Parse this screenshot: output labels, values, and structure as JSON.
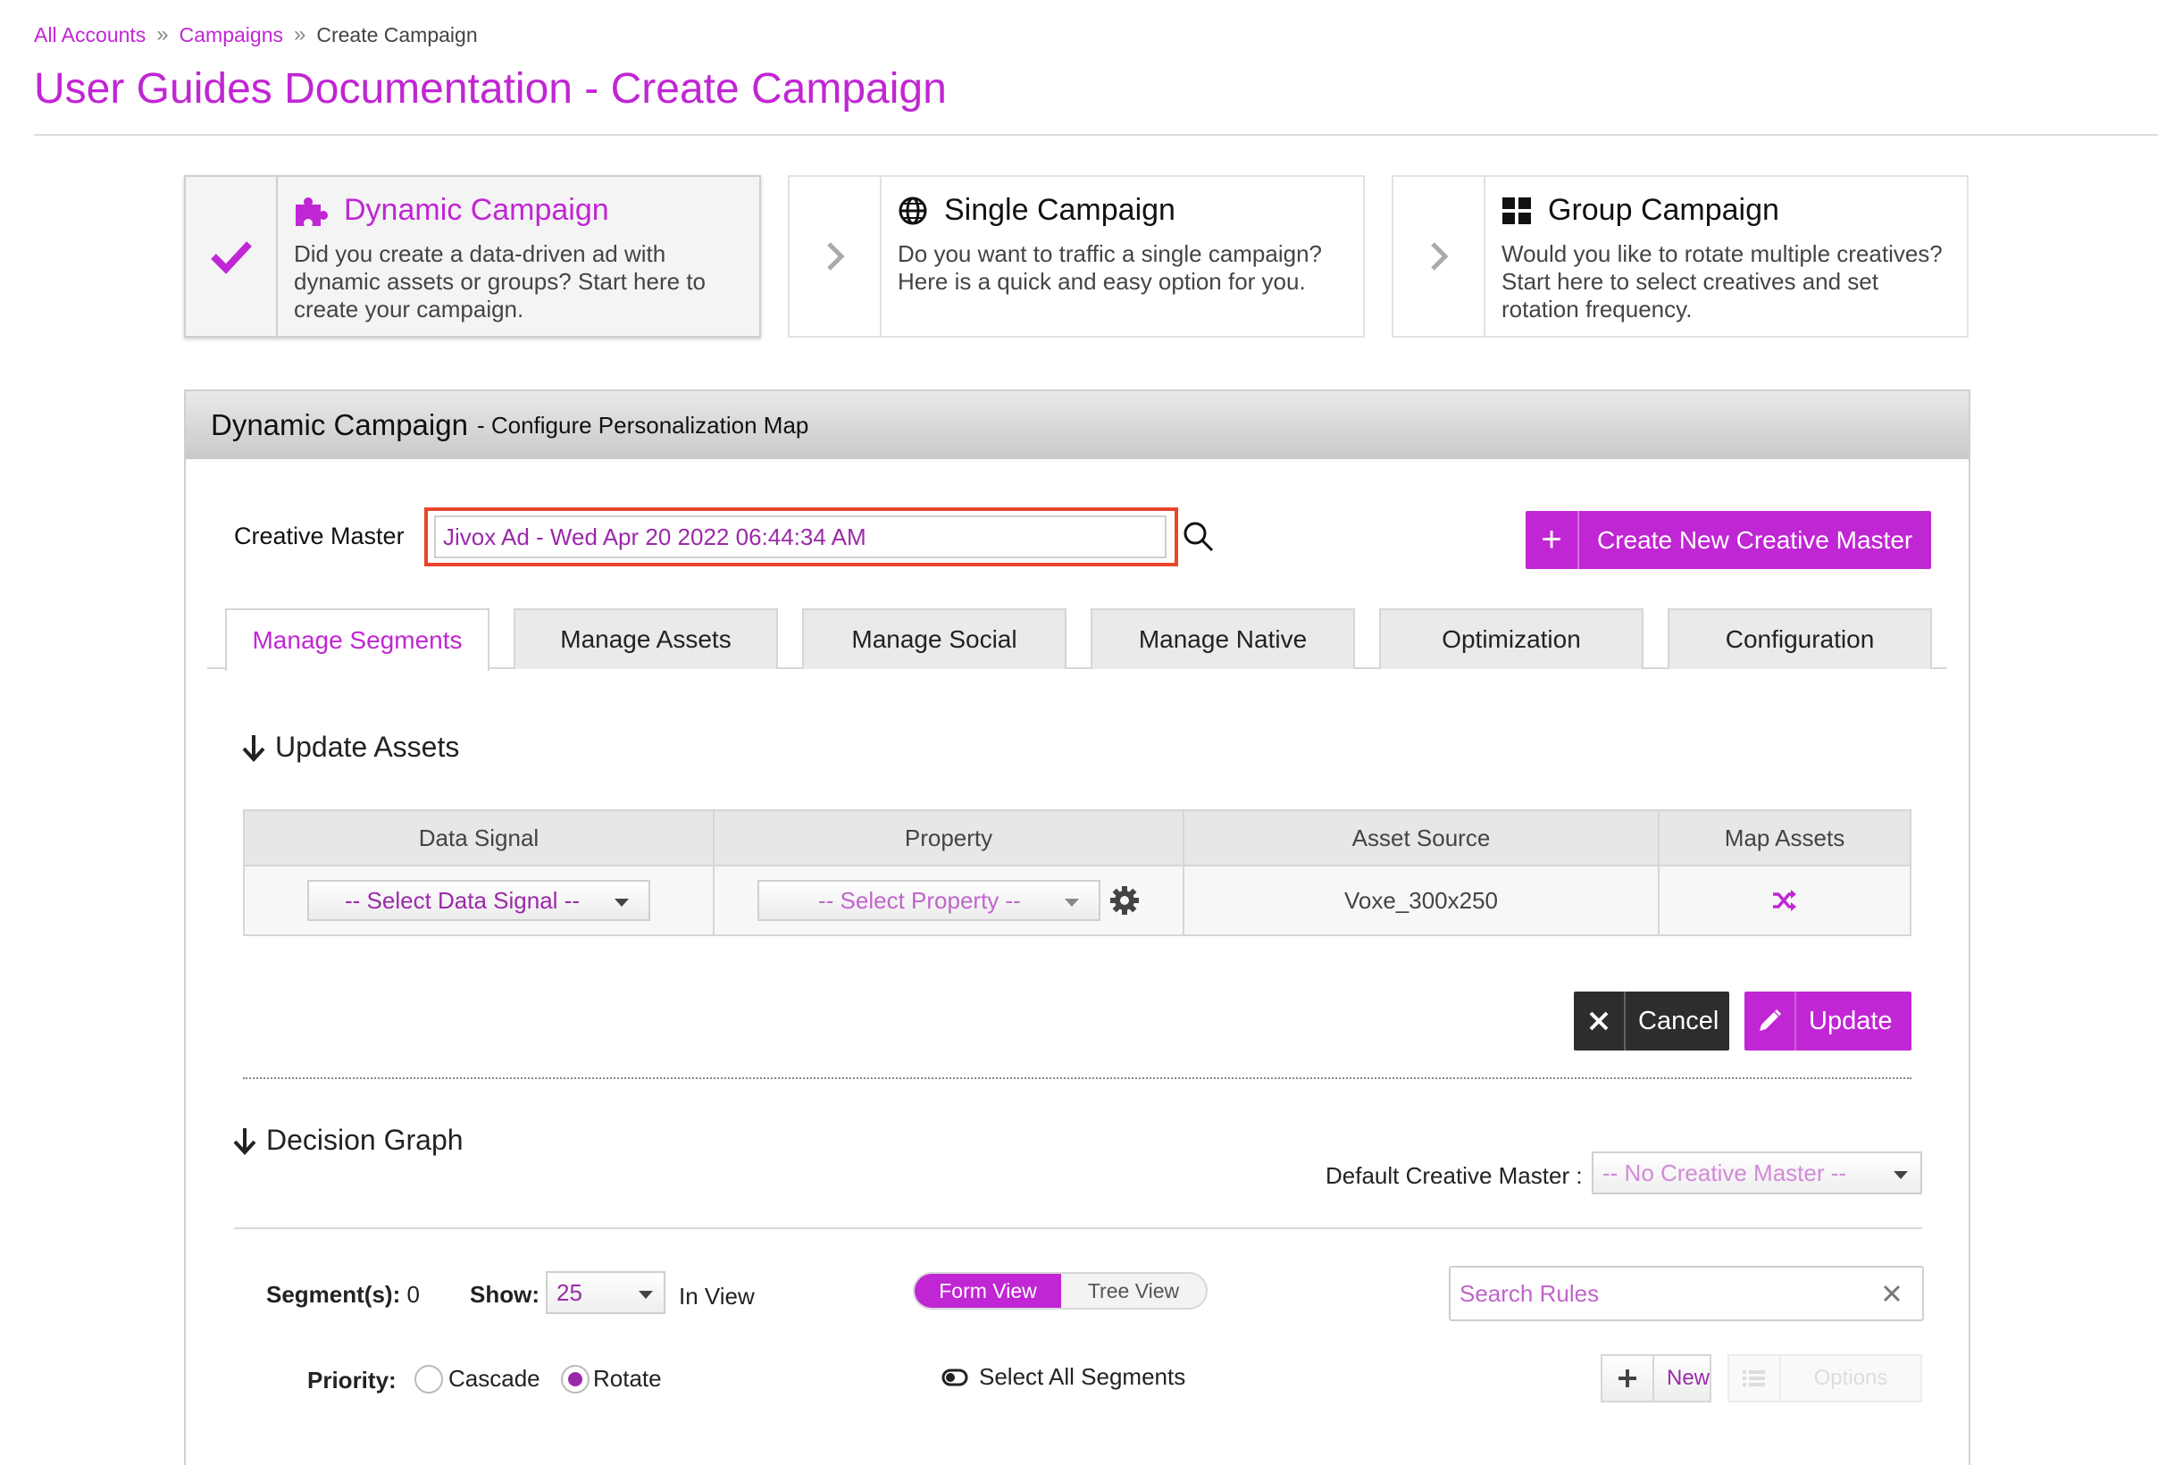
{
  "breadcrumb": {
    "items": [
      "All Accounts",
      "Campaigns",
      "Create Campaign"
    ],
    "separator": "»"
  },
  "page_title": "User Guides Documentation - Create Campaign",
  "cards": [
    {
      "title": "Dynamic Campaign",
      "desc_lines": [
        "Did you create a data-driven ad with",
        "dynamic assets or groups? Start here to",
        "create your campaign."
      ],
      "selected": true
    },
    {
      "title": "Single Campaign",
      "desc_lines": [
        "Do you want to traffic a single campaign?",
        "Here is a quick and easy option for you."
      ],
      "selected": false
    },
    {
      "title": "Group Campaign",
      "desc_lines": [
        "Would you like to rotate multiple creatives?",
        "Start here to select creatives and set",
        "rotation frequency."
      ],
      "selected": false
    }
  ],
  "panel": {
    "title": "Dynamic Campaign",
    "subtitle": "- Configure Personalization Map"
  },
  "creative_master": {
    "label": "Creative Master",
    "value": "Jivox Ad - Wed Apr 20 2022 06:44:34 AM",
    "create_button": "Create New Creative Master"
  },
  "tabs": [
    "Manage Segments",
    "Manage Assets",
    "Manage Social",
    "Manage Native",
    "Optimization",
    "Configuration"
  ],
  "active_tab": "Manage Segments",
  "update_assets": {
    "heading": "Update Assets",
    "columns": [
      "Data Signal",
      "Property",
      "Asset Source",
      "Map Assets"
    ],
    "row": {
      "data_signal": "-- Select Data Signal --",
      "property": "-- Select Property --",
      "asset_source": "Voxe_300x250"
    },
    "cancel_label": "Cancel",
    "update_label": "Update"
  },
  "decision_graph": {
    "heading": "Decision Graph",
    "default_cm_label": "Default Creative Master :",
    "default_cm_value": "-- No Creative Master --",
    "segments_label": "Segment(s):",
    "segments_count": "0",
    "show_label": "Show:",
    "show_value": "25",
    "in_view": "In View",
    "view_form": "Form View",
    "view_tree": "Tree View",
    "search_placeholder": "Search Rules",
    "priority_label": "Priority:",
    "priority_options": [
      "Cascade",
      "Rotate"
    ],
    "priority_selected": "Rotate",
    "select_all": "Select All Segments",
    "new_label": "New",
    "options_label": "Options"
  },
  "colors": {
    "accent": "#c026d3",
    "highlight_border": "#e8452a",
    "dark_button": "#2d2d2d"
  }
}
